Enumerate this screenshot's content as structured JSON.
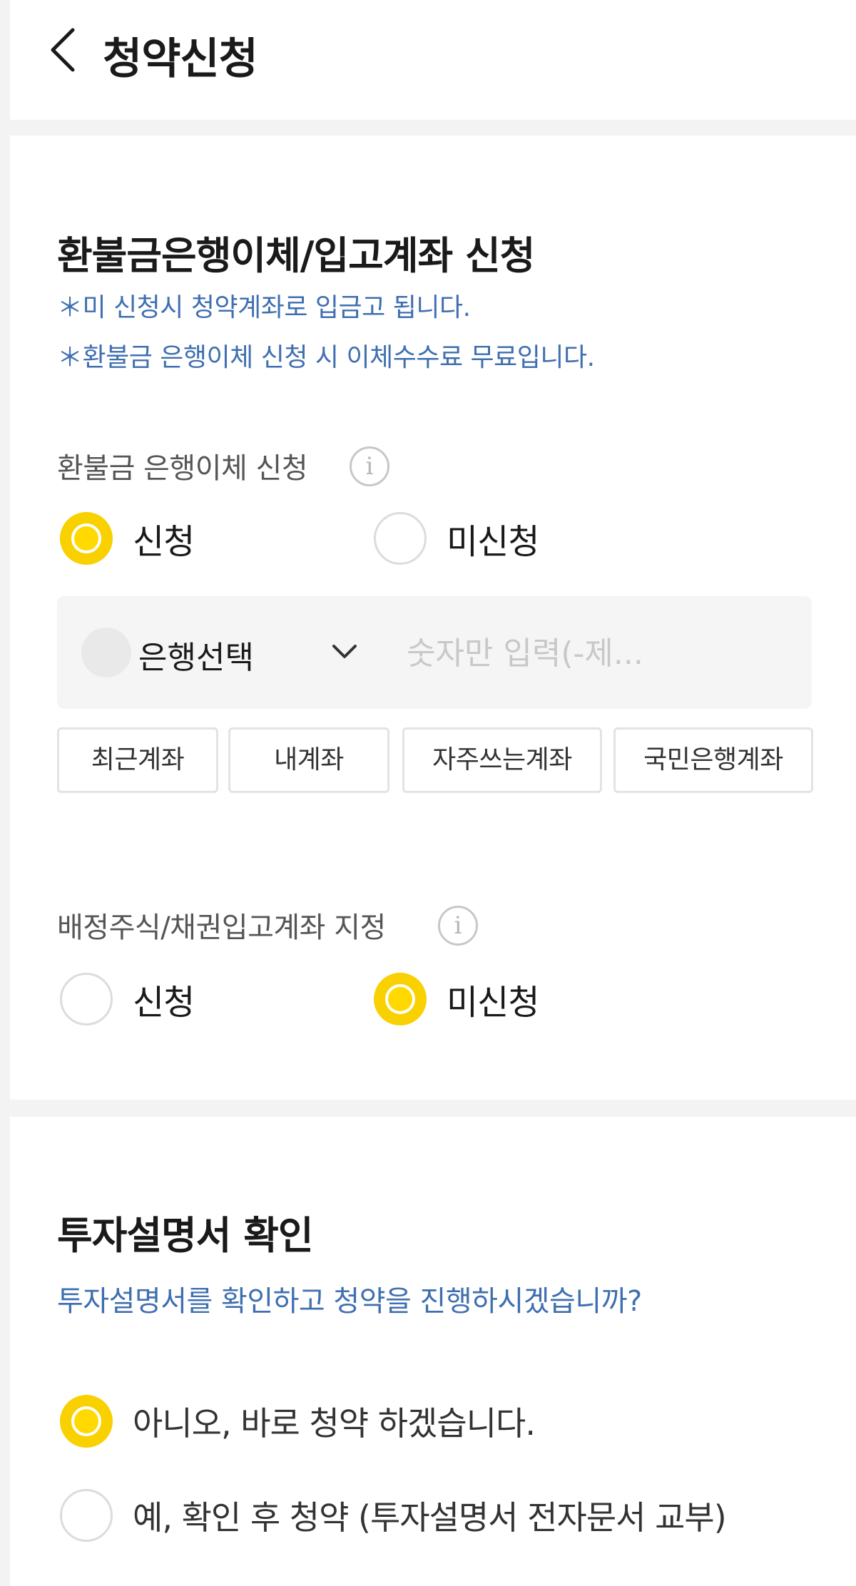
{
  "header": {
    "title": "청약신청"
  },
  "refund_section": {
    "title": "환불금은행이체/입고계좌 신청",
    "notes": [
      "＊미 신청시 청약계좌로 입금고 됩니다.",
      "＊환불금 은행이체 신청 시 이체수수료 무료입니다."
    ],
    "bank_transfer": {
      "label": "환불금 은행이체 신청",
      "info_icon": "i",
      "options": [
        "신청",
        "미신청"
      ],
      "selected": "신청"
    },
    "bank_select": {
      "label": "은행선택",
      "account_placeholder": "숫자만 입력(-제..."
    },
    "account_shortcuts": [
      "최근계좌",
      "내계좌",
      "자주쓰는계좌",
      "국민은행계좌"
    ],
    "deposit_account": {
      "label": "배정주식/채권입고계좌 지정",
      "info_icon": "i",
      "options": [
        "신청",
        "미신청"
      ],
      "selected": "미신청"
    }
  },
  "prospectus_section": {
    "title": "투자설명서 확인",
    "question": "투자설명서를 확인하고 청약을 진행하시겠습니까?",
    "options": [
      "아니오, 바로 청약 하겠습니다.",
      "예, 확인 후 청약 (투자설명서 전자문서 교부)"
    ],
    "selected_index": 0
  },
  "colors": {
    "accent_yellow": "#ffd900",
    "note_blue": "#3f6fb0",
    "divider_gray": "#f3f3f3"
  }
}
